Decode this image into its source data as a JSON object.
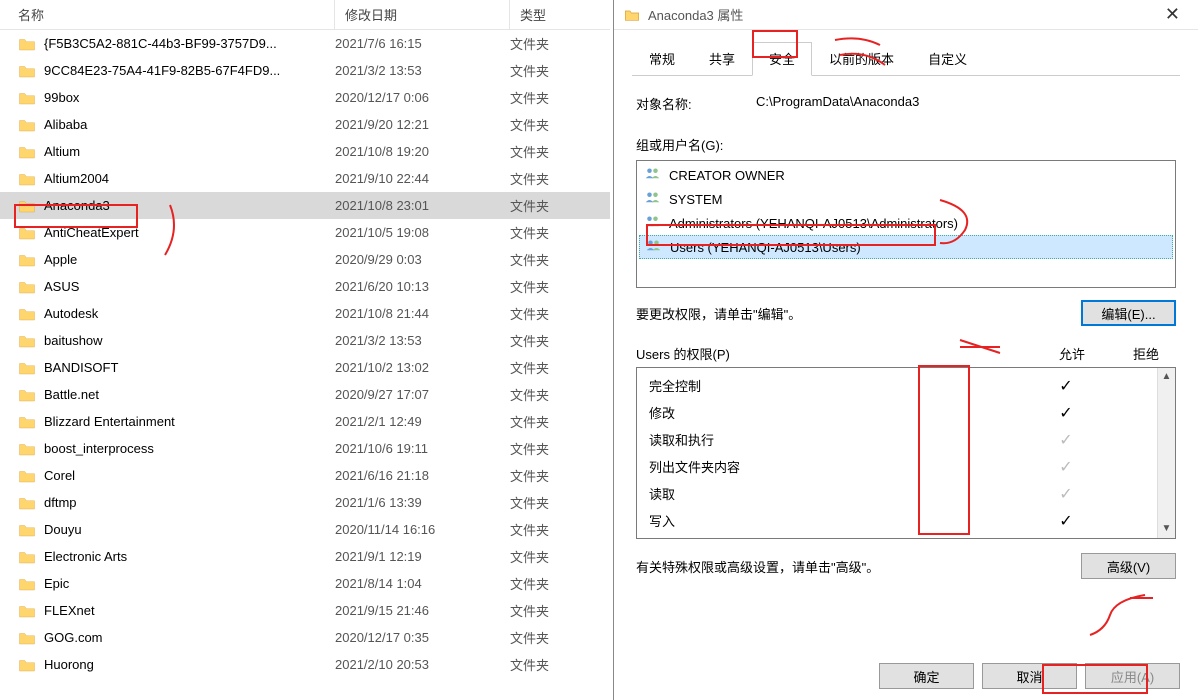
{
  "columns": {
    "name": "名称",
    "date": "修改日期",
    "type": "类型"
  },
  "folder_type": "文件夹",
  "files": [
    {
      "name": "{F5B3C5A2-881C-44b3-BF99-3757D9...",
      "date": "2021/7/6 16:15"
    },
    {
      "name": "9CC84E23-75A4-41F9-82B5-67F4FD9...",
      "date": "2021/3/2 13:53"
    },
    {
      "name": "99box",
      "date": "2020/12/17 0:06"
    },
    {
      "name": "Alibaba",
      "date": "2021/9/20 12:21"
    },
    {
      "name": "Altium",
      "date": "2021/10/8 19:20"
    },
    {
      "name": "Altium2004",
      "date": "2021/9/10 22:44"
    },
    {
      "name": "Anaconda3",
      "date": "2021/10/8 23:01",
      "selected": true
    },
    {
      "name": "AntiCheatExpert",
      "date": "2021/10/5 19:08"
    },
    {
      "name": "Apple",
      "date": "2020/9/29 0:03"
    },
    {
      "name": "ASUS",
      "date": "2021/6/20 10:13"
    },
    {
      "name": "Autodesk",
      "date": "2021/10/8 21:44"
    },
    {
      "name": "baitushow",
      "date": "2021/3/2 13:53"
    },
    {
      "name": "BANDISOFT",
      "date": "2021/10/2 13:02"
    },
    {
      "name": "Battle.net",
      "date": "2020/9/27 17:07"
    },
    {
      "name": "Blizzard Entertainment",
      "date": "2021/2/1 12:49"
    },
    {
      "name": "boost_interprocess",
      "date": "2021/10/6 19:11"
    },
    {
      "name": "Corel",
      "date": "2021/6/16 21:18"
    },
    {
      "name": "dftmp",
      "date": "2021/1/6 13:39"
    },
    {
      "name": "Douyu",
      "date": "2020/11/14 16:16"
    },
    {
      "name": "Electronic Arts",
      "date": "2021/9/1 12:19"
    },
    {
      "name": "Epic",
      "date": "2021/8/14 1:04"
    },
    {
      "name": "FLEXnet",
      "date": "2021/9/15 21:46"
    },
    {
      "name": "GOG.com",
      "date": "2020/12/17 0:35"
    },
    {
      "name": "Huorong",
      "date": "2021/2/10 20:53"
    }
  ],
  "dialog": {
    "title": "Anaconda3 属性",
    "tabs": {
      "general": "常规",
      "share": "共享",
      "security": "安全",
      "prev": "以前的版本",
      "custom": "自定义"
    },
    "object_label": "对象名称:",
    "object_value": "C:\\ProgramData\\Anaconda3",
    "groups_label": "组或用户名(G):",
    "groups": [
      {
        "name": "CREATOR OWNER"
      },
      {
        "name": "SYSTEM"
      },
      {
        "name": "Administrators (YEHANQI-AJ0513\\Administrators)"
      },
      {
        "name": "Users (YEHANQI-AJ0513\\Users)",
        "selected": true
      }
    ],
    "edit_hint": "要更改权限，请单击\"编辑\"。",
    "edit_btn": "编辑(E)...",
    "perm_label": "Users 的权限(P)",
    "allow": "允许",
    "deny": "拒绝",
    "perms": [
      {
        "name": "完全控制",
        "allow": "black"
      },
      {
        "name": "修改",
        "allow": "black"
      },
      {
        "name": "读取和执行",
        "allow": "gray"
      },
      {
        "name": "列出文件夹内容",
        "allow": "gray"
      },
      {
        "name": "读取",
        "allow": "gray"
      },
      {
        "name": "写入",
        "allow": "black"
      }
    ],
    "adv_hint": "有关特殊权限或高级设置，请单击\"高级\"。",
    "adv_btn": "高级(V)",
    "ok": "确定",
    "cancel": "取消",
    "apply": "应用(A)"
  }
}
